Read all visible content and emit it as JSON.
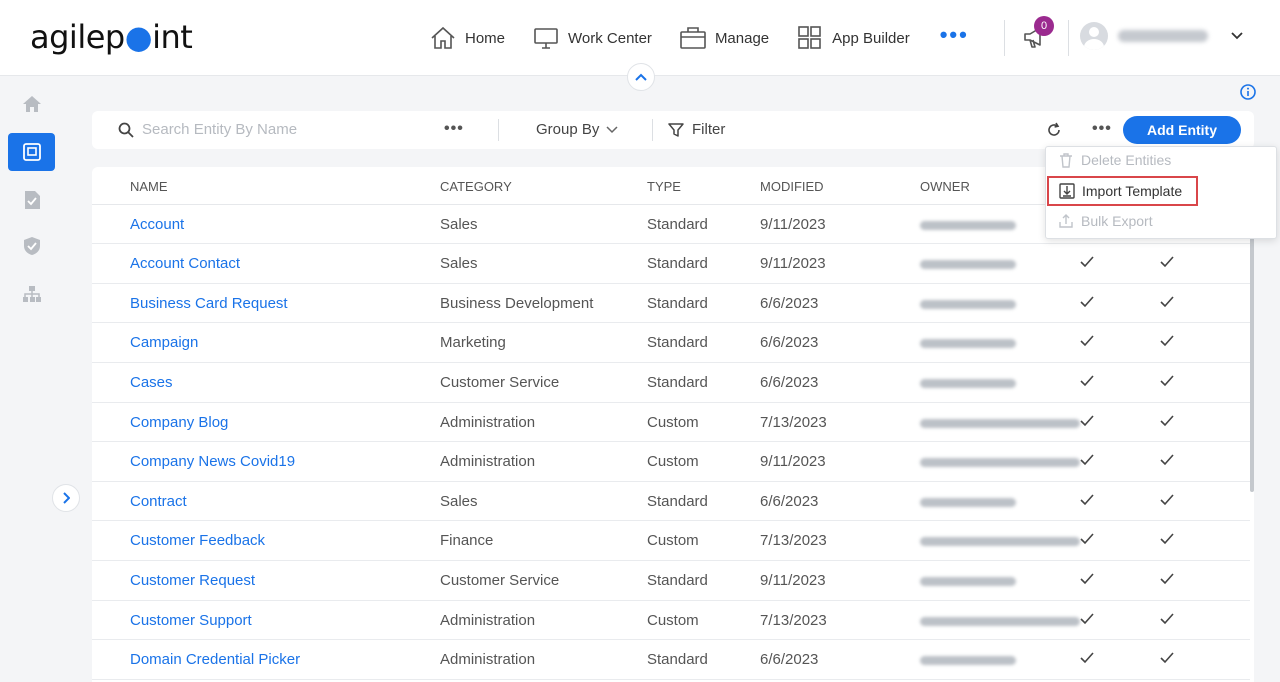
{
  "header": {
    "logo_text_a": "agilep",
    "logo_text_b": "int",
    "nav": [
      {
        "label": "Home",
        "icon": "home-icon"
      },
      {
        "label": "Work Center",
        "icon": "monitor-icon"
      },
      {
        "label": "Manage",
        "icon": "briefcase-icon"
      },
      {
        "label": "App Builder",
        "icon": "grid-icon"
      }
    ],
    "more_label": "•••",
    "notification_count": "0"
  },
  "sidebar": {
    "items": [
      "home-icon",
      "data-entities-icon",
      "task-check-icon",
      "shield-icon",
      "hierarchy-icon"
    ],
    "active_index": 1
  },
  "toolbar": {
    "search_placeholder": "Search Entity By Name",
    "more_label": "•••",
    "group_by_label": "Group By",
    "filter_label": "Filter",
    "add_button_label": "Add Entity"
  },
  "menu": {
    "items": [
      {
        "label": "Delete Entities",
        "enabled": false
      },
      {
        "label": "Import Template",
        "enabled": true
      },
      {
        "label": "Bulk Export",
        "enabled": false
      }
    ]
  },
  "table": {
    "columns": [
      "NAME",
      "CATEGORY",
      "TYPE",
      "MODIFIED",
      "OWNER"
    ],
    "rows": [
      {
        "name": "Account",
        "category": "Sales",
        "type": "Standard",
        "modified": "9/11/2023"
      },
      {
        "name": "Account Contact",
        "category": "Sales",
        "type": "Standard",
        "modified": "9/11/2023"
      },
      {
        "name": "Business Card Request",
        "category": "Business Development",
        "type": "Standard",
        "modified": "6/6/2023"
      },
      {
        "name": "Campaign",
        "category": "Marketing",
        "type": "Standard",
        "modified": "6/6/2023"
      },
      {
        "name": "Cases",
        "category": "Customer Service",
        "type": "Standard",
        "modified": "6/6/2023"
      },
      {
        "name": "Company Blog",
        "category": "Administration",
        "type": "Custom",
        "modified": "7/13/2023"
      },
      {
        "name": "Company News Covid19",
        "category": "Administration",
        "type": "Custom",
        "modified": "9/11/2023"
      },
      {
        "name": "Contract",
        "category": "Sales",
        "type": "Standard",
        "modified": "6/6/2023"
      },
      {
        "name": "Customer Feedback",
        "category": "Finance",
        "type": "Custom",
        "modified": "7/13/2023"
      },
      {
        "name": "Customer Request",
        "category": "Customer Service",
        "type": "Standard",
        "modified": "9/11/2023"
      },
      {
        "name": "Customer Support",
        "category": "Administration",
        "type": "Custom",
        "modified": "7/13/2023"
      },
      {
        "name": "Domain Credential Picker",
        "category": "Administration",
        "type": "Standard",
        "modified": "6/6/2023"
      }
    ]
  }
}
